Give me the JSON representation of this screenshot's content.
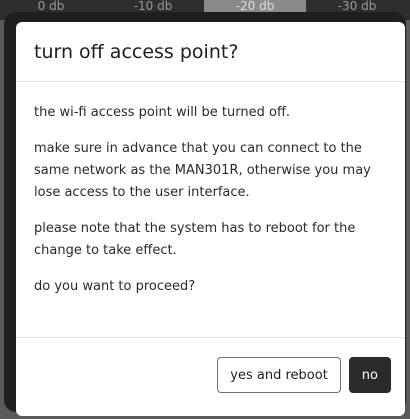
{
  "background": {
    "segments": [
      "0 db",
      "-10 db",
      "-20 db",
      "-30 db"
    ],
    "active_index": 2
  },
  "dialog": {
    "title": "turn off access point?",
    "paragraphs": [
      "the wi-fi access point will be turned off.",
      "make sure in advance that you can connect to the same network as the MAN301R, otherwise you may lose access to the user interface.",
      "please note that the system has to reboot for the change to take effect.",
      "do you want to proceed?"
    ],
    "buttons": {
      "confirm_label": "yes and reboot",
      "cancel_label": "no"
    }
  },
  "colors": {
    "primary_button": "#2b2b2b",
    "overlay": "#1f1f1f"
  }
}
